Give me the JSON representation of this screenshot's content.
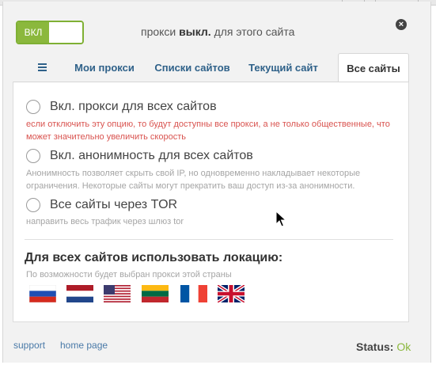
{
  "header": {
    "toggle_label": "ВКЛ",
    "status_prefix": "прокси ",
    "status_state": "выкл.",
    "status_suffix": " для этого сайта"
  },
  "tabs": [
    {
      "label": "Мои прокси"
    },
    {
      "label": "Списки сайтов"
    },
    {
      "label": "Текущий сайт"
    },
    {
      "label": "Все сайты",
      "active": true
    }
  ],
  "options": [
    {
      "label": "Вкл. прокси для всех сайтов",
      "desc": "если отключить эту опцию, то будут доступны все прокси, а не только общественные, что может значительно увеличить скорость",
      "checked": false
    },
    {
      "label": "Вкл. анонимность для всех сайтов",
      "desc": "Анонимность позволяет скрыть свой IP, но одновременно накладывает некоторые ограничения. Некоторые сайты могут прекратить ваш доступ из-за анонимности.",
      "checked": false
    },
    {
      "label": "Все сайты через TOR",
      "desc": "направить весь трафик через шлюз tor",
      "checked": false
    }
  ],
  "location": {
    "title": "Для всех сайтов использовать локацию:",
    "subtitle": "По возможности будет выбран прокси этой страны",
    "flags": [
      "russia-flag-icon",
      "netherlands-flag-icon",
      "usa-flag-icon",
      "lithuania-flag-icon",
      "france-flag-icon",
      "uk-flag-icon"
    ]
  },
  "footer": {
    "support": "support",
    "home_page": "home page",
    "status_label": "Status: ",
    "status_value": "Ok"
  },
  "colors": {
    "accent_green": "#8bb83d",
    "link_blue": "#2f6189",
    "warning_red": "#d9534f"
  }
}
